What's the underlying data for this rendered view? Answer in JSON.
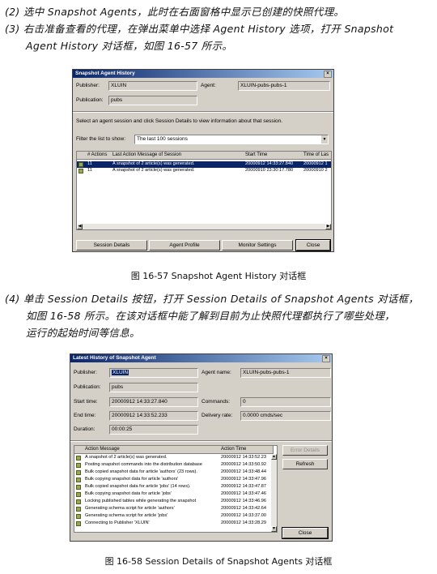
{
  "steps": [
    {
      "line1": "(2) 选中 Snapshot Agents，此时在右面窗格中显示已创建的快照代理。"
    },
    {
      "line1": "(3) 右击准备查看的代理，在弹出菜单中选择 Agent History 选项，打开 Snapshot",
      "line2": "Agent History 对话框，如图 16-57 所示。"
    },
    {
      "line1": "(4) 单击 Session Details 按钮，打开 Session Details of Snapshot Agents 对话框，",
      "line2": "如图 16-58 所示。在该对话框中能了解到目前为止快照代理都执行了哪些处理，",
      "line3": "运行的起始时间等信息。"
    }
  ],
  "fig1": {
    "title": "Snapshot Agent History",
    "close": "×",
    "publisher_label": "Publisher:",
    "publisher_value": "XLUIN",
    "agent_label": "Agent:",
    "agent_value": "XLUIN-pubs-pubs-1",
    "publication_label": "Publication:",
    "publication_value": "pubs",
    "instruction": "Select an agent session and click Session Details to view information about that session.",
    "filter_label": "Filter the list to show:",
    "filter_value": "The last 100 sessions",
    "columns": [
      "# Actions",
      "Last Action Message of Session",
      "Start Time",
      "Time of Las"
    ],
    "rows": [
      {
        "actions": "11",
        "message": "A snapshot of 2 article(s) was generated.",
        "start": "20000912 14:33:27.840",
        "last": "20000912 1"
      },
      {
        "actions": "11",
        "message": "A snapshot of 2 article(s) was generated.",
        "start": "20000910 23:30:17.780",
        "last": "20000910 2"
      }
    ],
    "buttons": {
      "session_details": "Session Details",
      "agent_profile": "Agent Profile",
      "monitor_settings": "Monitor Settings",
      "close": "Close"
    },
    "caption": "图 16-57  Snapshot Agent History 对话框"
  },
  "fig2": {
    "title": "Latest History of Snapshot Agent",
    "close": "×",
    "publisher_label": "Publisher:",
    "publisher_value": "XLUIN",
    "agent_name_label": "Agent name:",
    "agent_name_value": "XLUIN-pubs-pubs-1",
    "publication_label": "Publication:",
    "publication_value": "pubs",
    "start_label": "Start time:",
    "start_value": "20000912 14:33:27.840",
    "commands_label": "Commands:",
    "commands_value": "0",
    "end_label": "End time:",
    "end_value": "20000912 14:33:52.233",
    "delivery_label": "Delivery rate:",
    "delivery_value": "0.0000 cmds/sec",
    "duration_label": "Duration:",
    "duration_value": "00:00:25",
    "columns": [
      "Action Message",
      "Action Time"
    ],
    "rows": [
      {
        "message": "A snapshot of 2 article(s) was generated.",
        "time": "20000912 14:33:52.23"
      },
      {
        "message": "Posting snapshot commands into the distribution database",
        "time": "20000912 14:33:50.92"
      },
      {
        "message": "Bulk copied snapshot data for article 'authors' (23 rows).",
        "time": "20000912 14:33:48.44"
      },
      {
        "message": "Bulk copying snapshot data for article 'authors'",
        "time": "20000912 14:33:47.96"
      },
      {
        "message": "Bulk copied snapshot data for article 'jobs' (14 rows).",
        "time": "20000912 14:33:47.87"
      },
      {
        "message": "Bulk copying snapshot data for article 'jobs'",
        "time": "20000912 14:33:47.46"
      },
      {
        "message": "Locking published tables while generating the snapshot",
        "time": "20000912 14:33:46.96"
      },
      {
        "message": "Generating schema script for article 'authors'",
        "time": "20000912 14:33:42.64"
      },
      {
        "message": "Generating schema script for article 'jobs'",
        "time": "20000912 14:33:37.00"
      },
      {
        "message": "Connecting to Publisher 'XLUIN'",
        "time": "20000912 14:33:28.29"
      }
    ],
    "buttons": {
      "error_details": "Error Details",
      "refresh": "Refresh",
      "close": "Close"
    },
    "caption": "图 16-58  Session Details of Snapshot Agents 对话框"
  }
}
